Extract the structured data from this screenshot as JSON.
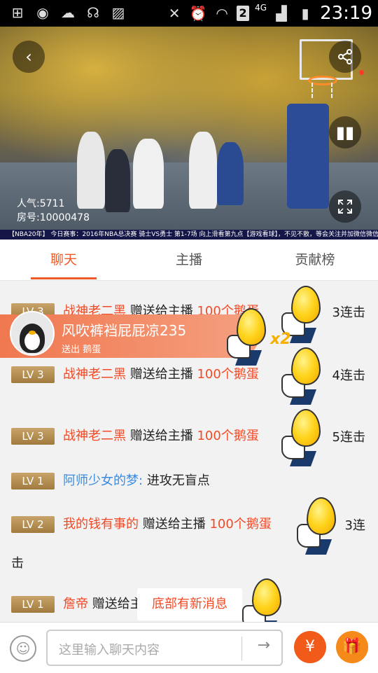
{
  "status_bar": {
    "network": "4G",
    "sim_slot": "2",
    "time": "23:19"
  },
  "video": {
    "popularity": "人气:5711",
    "room_number": "房号:10000478",
    "ticker": "【NBA20年】 今日赛事：2016年NBA总决赛 骑士VS勇士 第1-7场                    向上滑看第九点【游戏看球】，不见不散，等会关注并加微信微信：lpl721521"
  },
  "tabs": [
    {
      "label": "聊天",
      "active": true
    },
    {
      "label": "主播",
      "active": false
    },
    {
      "label": "贡献榜",
      "active": false
    }
  ],
  "gift_banner": {
    "user": "风吹裤裆屁屁凉235",
    "action": "送出  鹅蛋",
    "multiplier": "x2"
  },
  "messages": [
    {
      "level": "LV 3",
      "user": "战神老二黑",
      "action": "赠送给主播",
      "gift": "100个鹅蛋",
      "combo": "3连击"
    },
    {
      "level": "LV 3",
      "user": "战神老二黑",
      "action": "赠送给主播",
      "gift": "100个鹅蛋",
      "combo": "4连击"
    },
    {
      "level": "LV 3",
      "user": "战神老二黑",
      "action": "赠送给主播",
      "gift": "100个鹅蛋",
      "combo": "5连击"
    },
    {
      "level": "LV 1",
      "user": "阿师少女的梦:",
      "text": "进攻无盲点"
    },
    {
      "level": "LV 2",
      "user": "我的钱有事的",
      "action": "赠送给主播",
      "gift": "100个鹅蛋",
      "combo": "3连",
      "combo_wrap": "击"
    },
    {
      "level": "LV 1",
      "user": "詹帝",
      "action": "赠送给主"
    }
  ],
  "toast": "底部有新消息",
  "input": {
    "placeholder": "这里输入聊天内容"
  },
  "colors": {
    "accent": "#f05a28",
    "level_badge": "#b58a4e",
    "username_red": "#f04a26",
    "username_blue": "#3a8be0",
    "round_button": "#f5761a"
  },
  "icons": {
    "back": "back-arrow-icon",
    "share": "share-icon",
    "pause": "pause-icon",
    "fullscreen": "fullscreen-icon",
    "emoji": "smiley-icon",
    "send": "arrow-right-icon",
    "money": "money-bag-icon",
    "gift": "gift-box-icon"
  }
}
